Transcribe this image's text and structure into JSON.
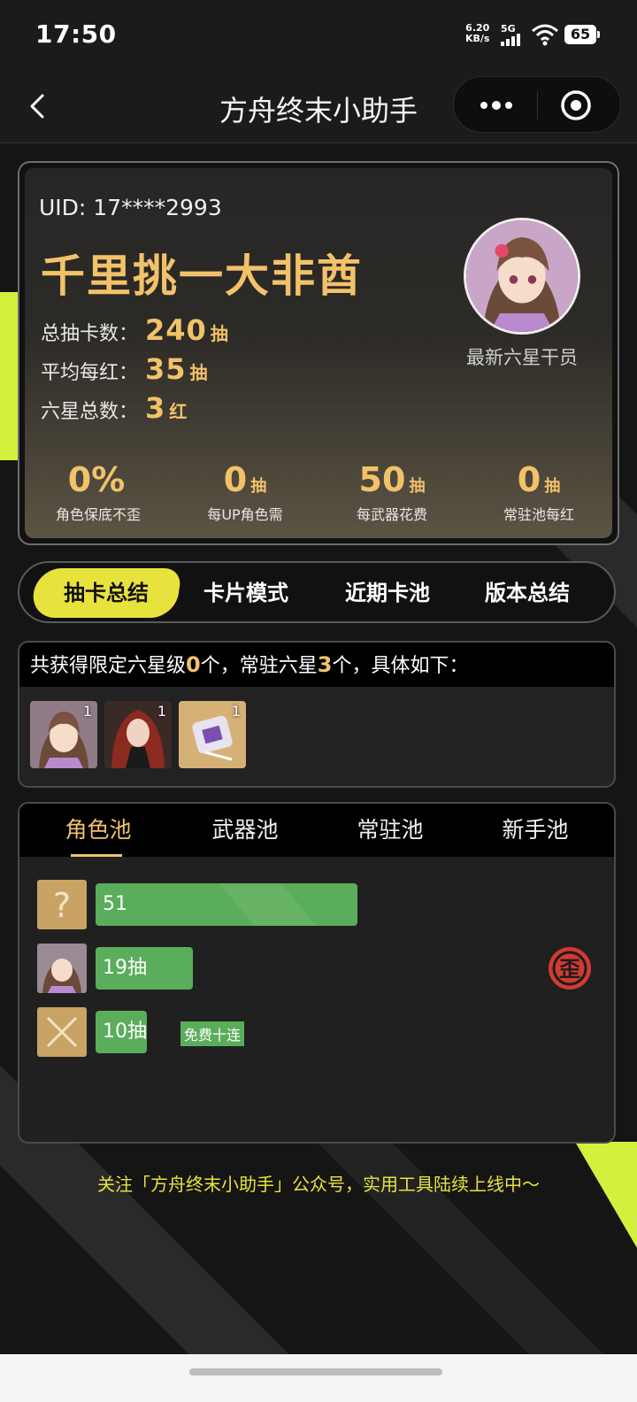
{
  "status": {
    "time": "17:50",
    "speed": "6.20",
    "speed_unit": "KB/s",
    "network": "5G",
    "battery": "65"
  },
  "nav": {
    "title": "方舟终末小助手"
  },
  "profile": {
    "uid": "UID: 17****2993",
    "rank_title": "千里挑一大非酋",
    "stats": [
      {
        "label": "总抽卡数：",
        "value": "240",
        "unit": "抽"
      },
      {
        "label": "平均每红：",
        "value": "35",
        "unit": "抽"
      },
      {
        "label": "六星总数：",
        "value": "3",
        "unit": "红"
      }
    ],
    "avatar_caption": "最新六星干员",
    "mini_stats": [
      {
        "value": "0%",
        "unit": "",
        "label": "角色保底不歪"
      },
      {
        "value": "0",
        "unit": "抽",
        "label": "每UP角色需"
      },
      {
        "value": "50",
        "unit": "抽",
        "label": "每武器花费"
      },
      {
        "value": "0",
        "unit": "抽",
        "label": "常驻池每红"
      }
    ]
  },
  "tabs": [
    "抽卡总结",
    "卡片模式",
    "近期卡池",
    "版本总结"
  ],
  "summary": {
    "prefix": "共获得限定六星级",
    "limited": "0",
    "middle": "个，常驻六星",
    "standard": "3",
    "suffix": "个，具体如下：",
    "operators": [
      {
        "name": "operator-1",
        "count": "1"
      },
      {
        "name": "operator-2",
        "count": "1"
      },
      {
        "name": "weapon-1",
        "count": "1"
      }
    ]
  },
  "pool": {
    "tabs": [
      "角色池",
      "武器池",
      "常驻池",
      "新手池"
    ],
    "rows": [
      {
        "icon": "question-icon",
        "label": "51",
        "fill": 0.51,
        "tag": ""
      },
      {
        "icon": "operator-portrait",
        "label": "19抽",
        "fill": 0.19,
        "tag": ""
      },
      {
        "icon": "cross-icon",
        "label": "10抽",
        "fill": 0.1,
        "tag": "免费十连"
      }
    ],
    "wai_badge": "歪"
  },
  "footer": "关注「方舟终末小助手」公众号，实用工具陆续上线中～",
  "colors": {
    "gold": "#f2c26a",
    "lime": "#e8e23d",
    "green": "#5aad5a"
  }
}
